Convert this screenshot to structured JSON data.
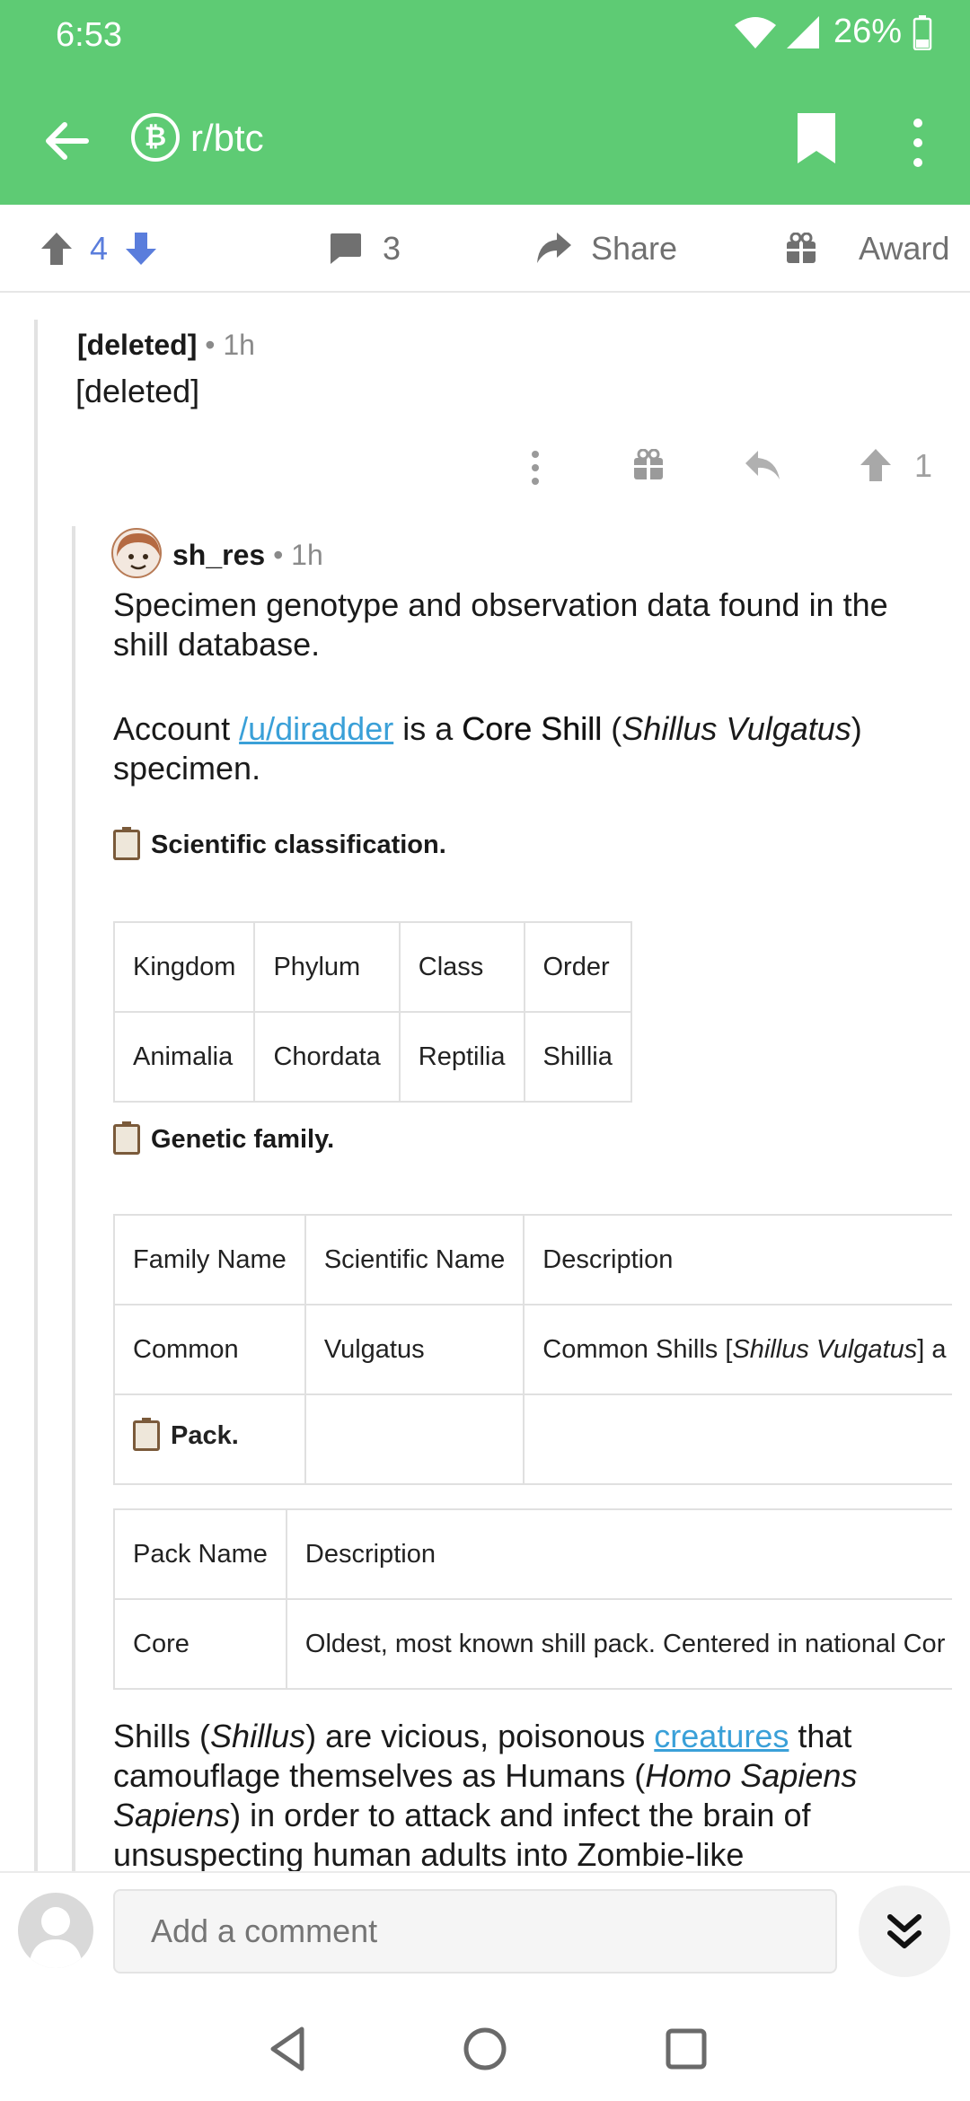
{
  "status": {
    "time": "6:53",
    "battery": "26%"
  },
  "app_bar": {
    "subreddit": "r/btc"
  },
  "post_actions": {
    "upvotes": "4",
    "comments": "3",
    "share": "Share",
    "award": "Award"
  },
  "comments": [
    {
      "author": "[deleted]",
      "age": "• 1h",
      "body": "[deleted]",
      "score": "1"
    },
    {
      "author": "sh_res",
      "age": "• 1h",
      "intro": "Specimen genotype and observation data found in the shill database.",
      "account_prefix": "Account ",
      "account_link": "/u/diradder",
      "account_mid": " is a ",
      "account_type": "Core Shill",
      "account_sci_open": " (",
      "account_sci": "Shillus Vulgatus",
      "account_sci_close": ")",
      "account_suffix": "specimen.",
      "heading_classification": "Scientific classification.",
      "classification_table": {
        "headers": [
          "Kingdom",
          "Phylum",
          "Class",
          "Order"
        ],
        "row": [
          "Animalia",
          "Chordata",
          "Reptilia",
          "Shillia"
        ]
      },
      "heading_family": "Genetic family.",
      "family_table": {
        "headers": [
          "Family Name",
          "Scientific Name",
          "Description"
        ],
        "row_name": "Common",
        "row_sci": "Vulgatus",
        "row_desc_prefix": "Common Shills [",
        "row_desc_italic": "Shillus Vulgatus",
        "row_desc_suffix": "] a"
      },
      "heading_pack": "Pack.",
      "pack_table": {
        "headers": [
          "Pack Name",
          "Description"
        ],
        "row": [
          "Core",
          "Oldest, most known shill pack. Centered in national Cor"
        ]
      },
      "paragraph_prefix": "Shills (",
      "paragraph_shillus": "Shillus",
      "paragraph_mid1": ") are vicious, poisonous ",
      "paragraph_link": "creatures",
      "paragraph_mid2": " that camouflage themselves as Humans (",
      "paragraph_homo": "Homo Sapiens Sapiens",
      "paragraph_end": ") in order to attack and infect the brain of unsuspecting human adults into Zombie-like"
    }
  ],
  "composer": {
    "placeholder": "Add a comment"
  },
  "colors": {
    "header": "#5ecb74",
    "link": "#3aa0d8",
    "vote": "#5a7ddc"
  }
}
